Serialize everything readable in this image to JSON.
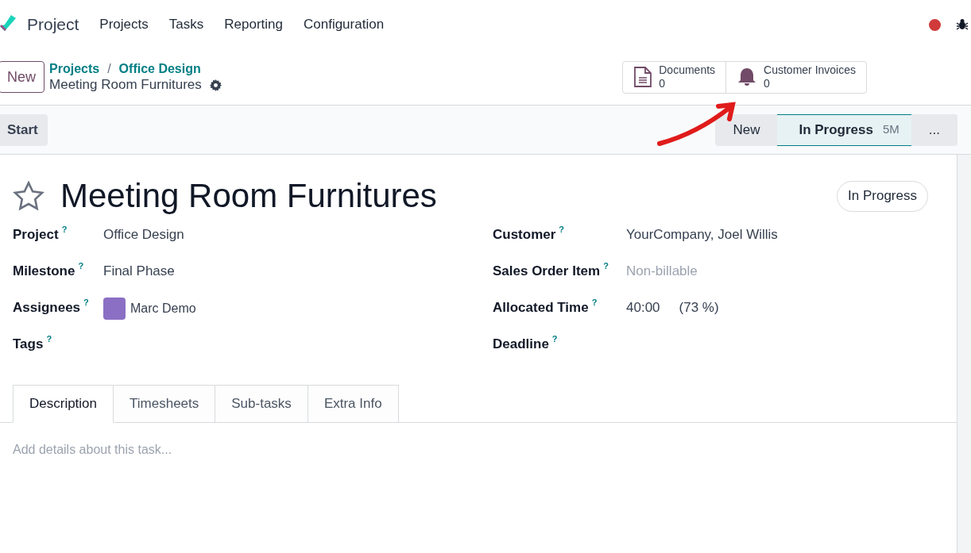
{
  "app": {
    "name": "Project"
  },
  "menu": [
    "Projects",
    "Tasks",
    "Reporting",
    "Configuration"
  ],
  "control_panel": {
    "new_button": "New",
    "breadcrumbs": [
      "Projects",
      "Office Design"
    ],
    "breadcrumb_separator": "/",
    "record_name": "Meeting Room Furnitures"
  },
  "smart_buttons": [
    {
      "kind": "document",
      "label": "Documents",
      "count": "0"
    },
    {
      "kind": "bell",
      "label": "Customer Invoices",
      "count": "0"
    }
  ],
  "action_button": "Start",
  "stages": [
    {
      "label": "New",
      "selected": false
    },
    {
      "label": "In Progress",
      "duration": "5M",
      "selected": true
    },
    {
      "label": "...",
      "selected": false
    }
  ],
  "task": {
    "title": "Meeting Room Furnitures",
    "starred": false,
    "state_badge": "In Progress"
  },
  "fields_left": [
    {
      "label": "Project",
      "help": "?",
      "value": "Office Design",
      "kind": "text"
    },
    {
      "label": "Milestone",
      "help": "?",
      "value": "Final Phase",
      "kind": "text"
    },
    {
      "label": "Assignees",
      "help": "?",
      "value": "Marc Demo",
      "kind": "user"
    },
    {
      "label": "Tags",
      "help": "?",
      "kind": "empty"
    }
  ],
  "fields_right": [
    {
      "label": "Customer",
      "help": "?",
      "value": "YourCompany, Joel Willis",
      "kind": "text"
    },
    {
      "label": "Sales Order Item",
      "help": "?",
      "placeholder": "Non-billable",
      "kind": "muted"
    },
    {
      "label": "Allocated Time",
      "help": "?",
      "value": "40:00",
      "extra": "(73 %)",
      "kind": "time"
    },
    {
      "label": "Deadline",
      "help": "?",
      "kind": "empty"
    }
  ],
  "tabs": [
    {
      "label": "Description",
      "selected": true
    },
    {
      "label": "Timesheets",
      "selected": false
    },
    {
      "label": "Sub-tasks",
      "selected": false
    },
    {
      "label": "Extra Info",
      "selected": false
    }
  ],
  "description": {
    "placeholder": "Add details about this task..."
  }
}
